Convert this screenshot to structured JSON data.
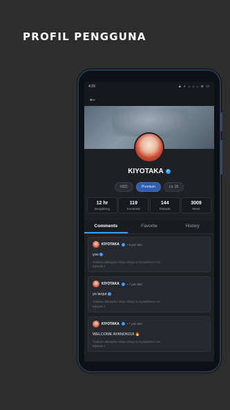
{
  "heading": "PROFIL PENGGUNA",
  "status": {
    "time": "4:29",
    "icons": "▲ ◐ ᵢₗ ᵢₗ ᵢₗ ≋ ▭"
  },
  "profile": {
    "username": "KIYOTAKA",
    "chips": {
      "id": "#321",
      "premium": "Premium",
      "level": "Lv. 15"
    }
  },
  "stats": [
    {
      "value": "12 hr",
      "label": "Bergabung"
    },
    {
      "value": "119",
      "label": "Komentar"
    },
    {
      "value": "144",
      "label": "Riwayat"
    },
    {
      "value": "3009",
      "label": "Menit"
    }
  ],
  "tabs": [
    {
      "label": "Comments"
    },
    {
      "label": "Favorite"
    },
    {
      "label": "History"
    }
  ],
  "comments": [
    {
      "name": "KIYOTAKA",
      "time": "• 6 jam lalu",
      "text": "yoo",
      "ref": "Youkoso Jitsuryoku Shijou Shugi no Kyoushitsu e S4",
      "episode": "Episode 1"
    },
    {
      "name": "KIYOTAKA",
      "time": "• 7 jam lalu",
      "text": "yo lanjut",
      "ref": "Youkoso Jitsuryoku Shijou Shugi no Kyoushitsu e S4",
      "episode": "Episode 2"
    },
    {
      "name": "KIYOTAKA",
      "time": "• 7 jam lalu",
      "text": "WELCOME AYANOKOJI 🔥",
      "ref": "Youkoso Jitsuryoku Shijou Shugi no Kyoushitsu e S4",
      "episode": "Episode 1"
    }
  ]
}
